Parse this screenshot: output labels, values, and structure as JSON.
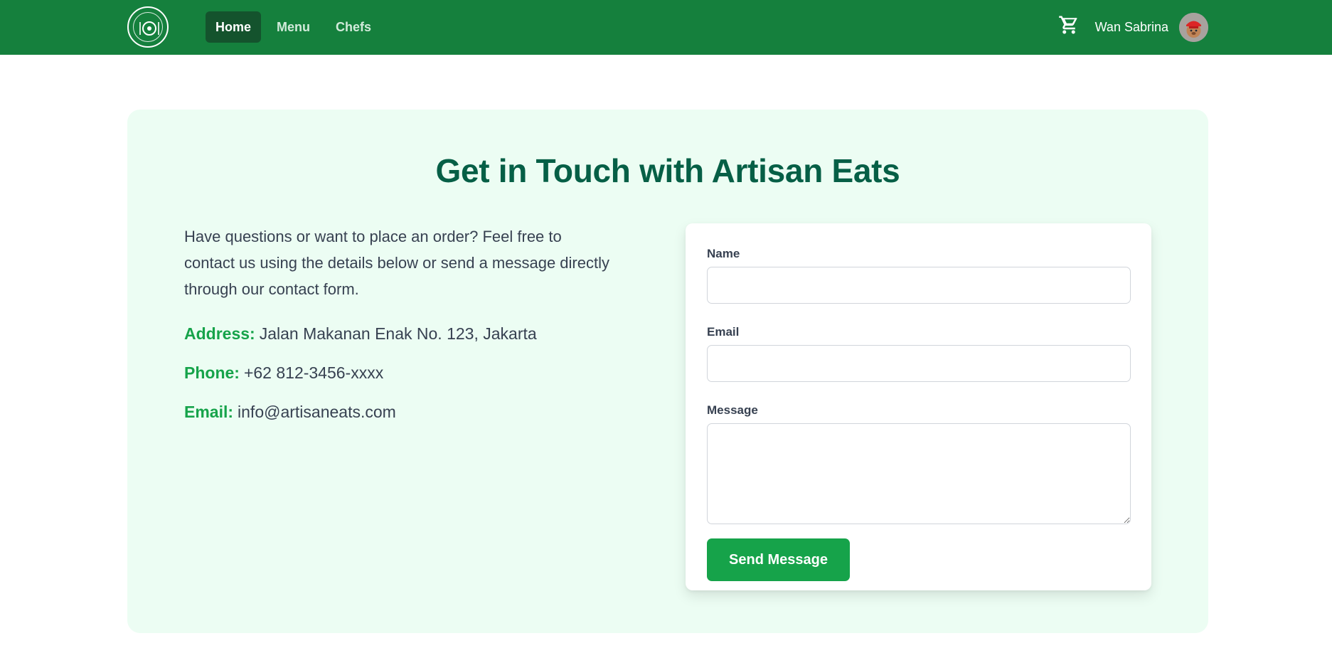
{
  "nav": {
    "links": [
      "Home",
      "Menu",
      "Chefs"
    ],
    "active_link": "Home",
    "user_name": "Wan Sabrina",
    "logo_icon": "artisan-eats-logo",
    "cart_icon": "cart-icon",
    "avatar_icon": "user-avatar"
  },
  "contact": {
    "title": "Get in Touch with Artisan Eats",
    "intro": "Have questions or want to place an order? Feel free to contact us using the details below or send a message directly through our contact form.",
    "address_label": "Address:",
    "address_value": "Jalan Makanan Enak No. 123, Jakarta",
    "phone_label": "Phone:",
    "phone_value": "+62 812-3456-xxxx",
    "email_label": "Email:",
    "email_value": "info@artisaneats.com"
  },
  "form": {
    "name_label": "Name",
    "name_value": "",
    "email_label": "Email",
    "email_value": "",
    "message_label": "Message",
    "message_value": "",
    "submit_label": "Send Message"
  },
  "colors": {
    "navbar": "#15803d",
    "nav_active": "#14532d",
    "card_background": "#ecfdf3",
    "title": "#065f46",
    "accent": "#16a34a"
  }
}
